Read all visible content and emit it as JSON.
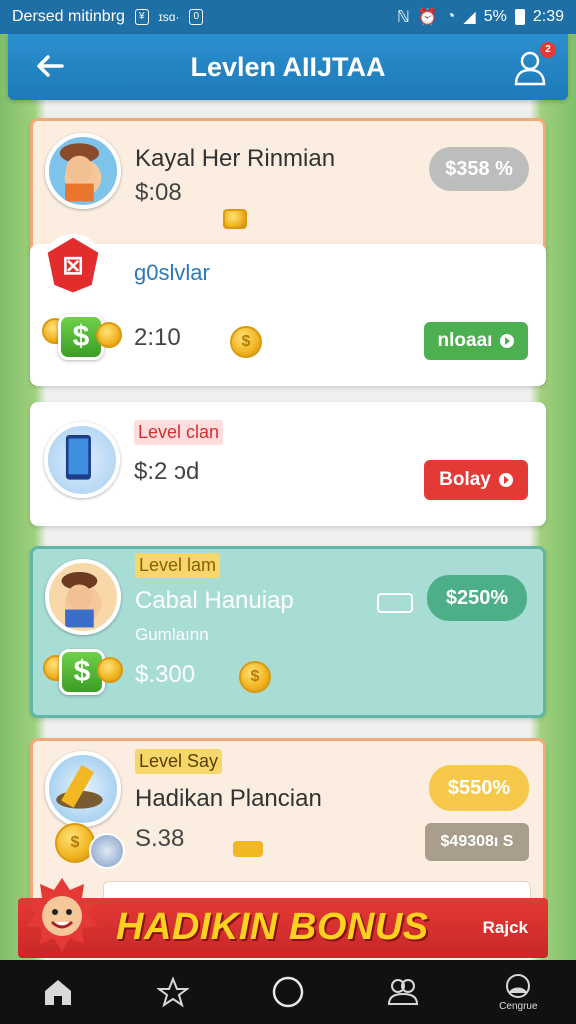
{
  "status_bar": {
    "carrier": "Dersed mitinbrg",
    "box1": "¥",
    "mid": "ɪsɑ·",
    "box2": "0",
    "signal": "5%",
    "time": "2:39"
  },
  "header": {
    "title": "Levlen AIIJTAA",
    "notification_count": "2",
    "accent": "#1f7fbf"
  },
  "cards": [
    {
      "name": "Kayal Her Rinmian",
      "amount": "$:08",
      "pill": "$358 %",
      "pill_color": "#bdbdbd",
      "bg": "#fbeee0",
      "border": "#f2a97a"
    },
    {
      "name": "g0slvlar",
      "amount": "2:10",
      "button": "nloaaı",
      "button_color": "#4caf50",
      "bg": "#ffffff"
    },
    {
      "level": "Level clan",
      "amount": "$:2 ɔd",
      "button": "Bolay",
      "button_color": "#e53935",
      "bg": "#ffffff"
    },
    {
      "level": "Level lam",
      "name": "Cabal Hanuiap",
      "subtitle": "Gumlaınn",
      "amount": "$.300",
      "pill": "$250%",
      "pill_color": "#4caf88",
      "bg": "#a8ddd6",
      "border": "#5fb8a6"
    },
    {
      "level": "Level Say",
      "name": "Hadikan Plancian",
      "amount": "S.38",
      "pill": "$550%",
      "pill_color": "#f7c94b",
      "tag": "$49308ı S",
      "tag_color": "#a99e8c",
      "bg": "#fbeee0",
      "border": "#f2a97a"
    }
  ],
  "bonus": {
    "label": "HADIKIN BONUS",
    "aside": "Rajck"
  },
  "nav": {
    "items": [
      {
        "icon": "home-icon",
        "label": ""
      },
      {
        "icon": "star-icon",
        "label": ""
      },
      {
        "icon": "circle-icon",
        "label": ""
      },
      {
        "icon": "people-icon",
        "label": ""
      },
      {
        "icon": "profile-icon",
        "label": "Cengrue"
      }
    ]
  }
}
